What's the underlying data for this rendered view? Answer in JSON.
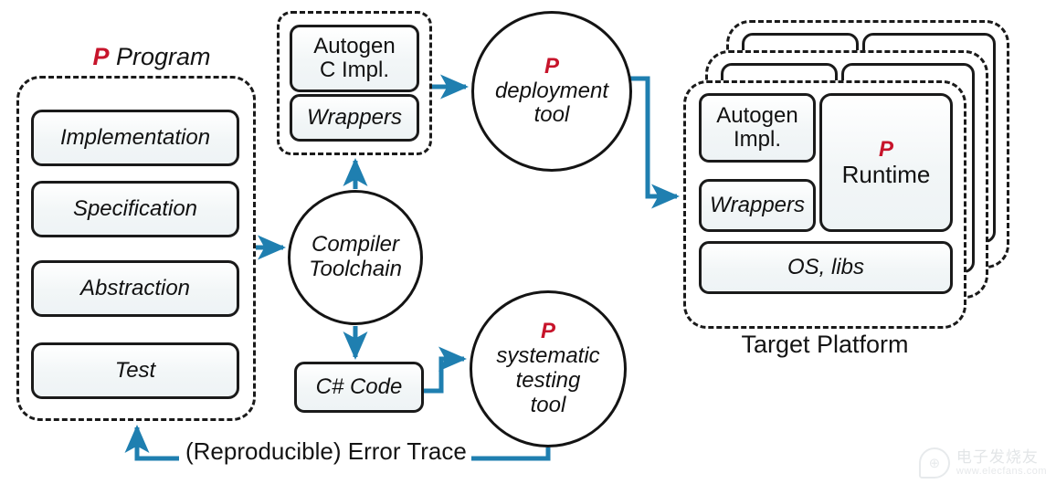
{
  "diagram": {
    "title": "P language workflow diagram",
    "accent_arrow_color": "#1f7fb0",
    "p_mark_color": "#c7142b",
    "node_border_color": "#1a1a1a"
  },
  "program": {
    "p_mark": "P",
    "title": "Program",
    "items": [
      {
        "label": "Implementation"
      },
      {
        "label": "Specification"
      },
      {
        "label": "Abstraction"
      },
      {
        "label": "Test"
      }
    ]
  },
  "autogen_group": {
    "c_impl_label": "Autogen\nC Impl.",
    "c_impl_line1": "Autogen",
    "c_impl_line2": "C Impl.",
    "wrappers_label": "Wrappers"
  },
  "compiler": {
    "line1": "Compiler",
    "line2": "Toolchain"
  },
  "deployment_tool": {
    "p_mark": "P",
    "line1": "deployment",
    "line2": "tool"
  },
  "testing_tool": {
    "p_mark": "P",
    "line1": "systematic",
    "line2": "testing",
    "line3": "tool"
  },
  "csharp": {
    "label": "C# Code"
  },
  "target_platform": {
    "caption": "Target Platform",
    "autogen_impl_line1": "Autogen",
    "autogen_impl_line2": "Impl.",
    "wrappers_label": "Wrappers",
    "runtime_p_mark": "P",
    "runtime_label": "Runtime",
    "os_libs_label": "OS, libs",
    "stack_count": 3
  },
  "edges": {
    "error_trace_label": "(Reproducible) Error Trace",
    "program_to_compiler": "",
    "compiler_to_autogen": "",
    "autogen_to_deployment": "",
    "deployment_to_platform": "",
    "compiler_to_csharp": "",
    "csharp_to_testing": ""
  },
  "watermark": {
    "logo_glyph": "⊕",
    "chinese_text": "电子发烧友",
    "url_text": "www.elecfans.com"
  }
}
